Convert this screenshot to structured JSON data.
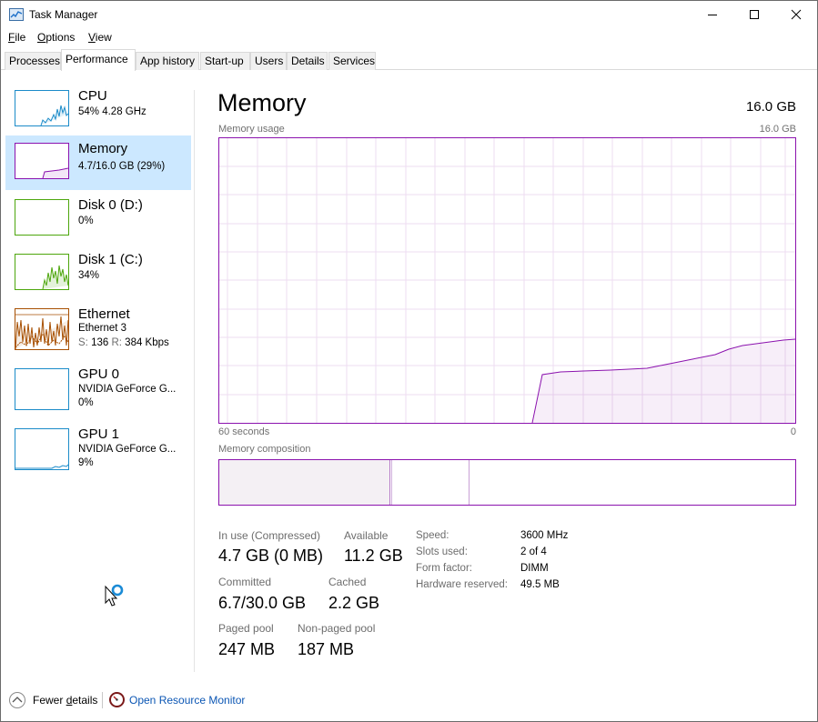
{
  "window": {
    "title": "Task Manager",
    "controls": {
      "minimize": "—",
      "maximize": "☐",
      "close": "✕"
    }
  },
  "menu": [
    {
      "accel": "F",
      "rest": "ile"
    },
    {
      "accel": "O",
      "rest": "ptions"
    },
    {
      "accel": "V",
      "rest": "iew"
    }
  ],
  "tabs": [
    {
      "label": "Processes"
    },
    {
      "label": "Performance",
      "active": true
    },
    {
      "label": "App history"
    },
    {
      "label": "Start-up"
    },
    {
      "label": "Users"
    },
    {
      "label": "Details"
    },
    {
      "label": "Services"
    }
  ],
  "sidebar": {
    "items": [
      {
        "title": "CPU",
        "line1": "54% 4.28 GHz",
        "line2": "",
        "color": "#1b8bc9"
      },
      {
        "title": "Memory",
        "line1": "4.7/16.0 GB (29%)",
        "line2": "",
        "color": "#8b12ae",
        "selected": true
      },
      {
        "title": "Disk 0 (D:)",
        "line1": "0%",
        "line2": "",
        "color": "#4da60c"
      },
      {
        "title": "Disk 1 (C:)",
        "line1": "34%",
        "line2": "",
        "color": "#4da60c"
      },
      {
        "title": "Ethernet",
        "line1": "Ethernet 3",
        "line2_s_label": "S:",
        "line2_s": "136",
        "line2_r_label": "R:",
        "line2_r": "384 Kbps",
        "color": "#a74f01"
      },
      {
        "title": "GPU 0",
        "line1": "NVIDIA GeForce G...",
        "line2": "0%",
        "color": "#1b8bc9"
      },
      {
        "title": "GPU 1",
        "line1": "NVIDIA GeForce G...",
        "line2": "9%",
        "color": "#1b8bc9"
      }
    ]
  },
  "main": {
    "title": "Memory",
    "total": "16.0 GB",
    "usage_label": "Memory usage",
    "usage_max": "16.0 GB",
    "time_left": "60 seconds",
    "time_right": "0",
    "composition_label": "Memory composition",
    "stats": {
      "in_use_label": "In use (Compressed)",
      "in_use_value": "4.7 GB (0 MB)",
      "available_label": "Available",
      "available_value": "11.2 GB",
      "committed_label": "Committed",
      "committed_value": "6.7/30.0 GB",
      "cached_label": "Cached",
      "cached_value": "2.2 GB",
      "paged_label": "Paged pool",
      "paged_value": "247 MB",
      "nonpaged_label": "Non-paged pool",
      "nonpaged_value": "187 MB"
    },
    "specs": [
      {
        "label": "Speed:",
        "value": "3600 MHz"
      },
      {
        "label": "Slots used:",
        "value": "2 of 4"
      },
      {
        "label": "Form factor:",
        "value": "DIMM"
      },
      {
        "label": "Hardware reserved:",
        "value": "49.5 MB"
      }
    ]
  },
  "footer": {
    "fewer_details_pre": "Fewer ",
    "fewer_details_accel": "d",
    "fewer_details_post": "etails",
    "resource_monitor": "Open Resource Monitor"
  },
  "colors": {
    "accent_memory": "#8b12ae",
    "selected_bg": "#cce8ff",
    "link": "#0b56b4"
  }
}
